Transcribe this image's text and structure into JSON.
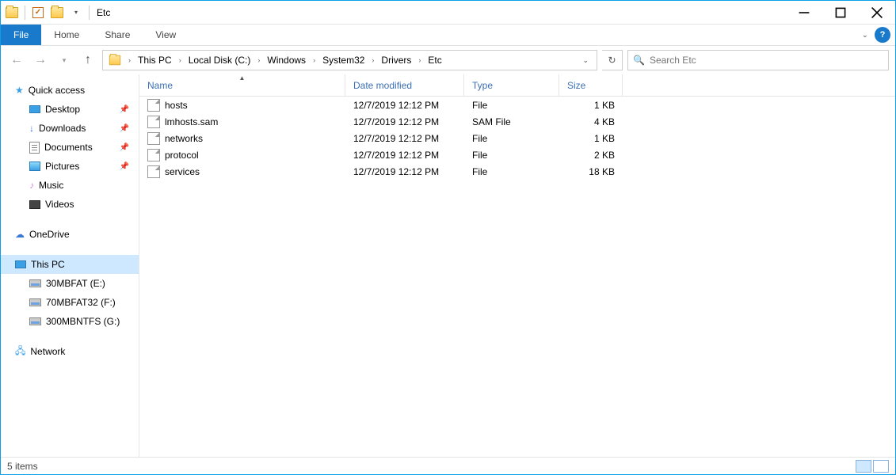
{
  "window": {
    "title": "Etc"
  },
  "ribbon": {
    "file": "File",
    "tabs": [
      "Home",
      "Share",
      "View"
    ]
  },
  "breadcrumb": [
    "This PC",
    "Local Disk (C:)",
    "Windows",
    "System32",
    "Drivers",
    "Etc"
  ],
  "search": {
    "placeholder": "Search Etc"
  },
  "columns": {
    "name": "Name",
    "date": "Date modified",
    "type": "Type",
    "size": "Size"
  },
  "navpane": {
    "quick_access": "Quick access",
    "quick_items": [
      {
        "label": "Desktop",
        "icon": "desktop",
        "pinned": true
      },
      {
        "label": "Downloads",
        "icon": "downloads",
        "pinned": true
      },
      {
        "label": "Documents",
        "icon": "documents",
        "pinned": true
      },
      {
        "label": "Pictures",
        "icon": "pictures",
        "pinned": true
      },
      {
        "label": "Music",
        "icon": "music",
        "pinned": false
      },
      {
        "label": "Videos",
        "icon": "videos",
        "pinned": false
      }
    ],
    "onedrive": "OneDrive",
    "this_pc": "This PC",
    "drives": [
      {
        "label": "30MBFAT (E:)"
      },
      {
        "label": "70MBFAT32 (F:)"
      },
      {
        "label": "300MBNTFS (G:)"
      }
    ],
    "network": "Network"
  },
  "files": [
    {
      "name": "hosts",
      "date": "12/7/2019 12:12 PM",
      "type": "File",
      "size": "1 KB"
    },
    {
      "name": "lmhosts.sam",
      "date": "12/7/2019 12:12 PM",
      "type": "SAM File",
      "size": "4 KB"
    },
    {
      "name": "networks",
      "date": "12/7/2019 12:12 PM",
      "type": "File",
      "size": "1 KB"
    },
    {
      "name": "protocol",
      "date": "12/7/2019 12:12 PM",
      "type": "File",
      "size": "2 KB"
    },
    {
      "name": "services",
      "date": "12/7/2019 12:12 PM",
      "type": "File",
      "size": "18 KB"
    }
  ],
  "status": {
    "count_label": "5 items"
  }
}
